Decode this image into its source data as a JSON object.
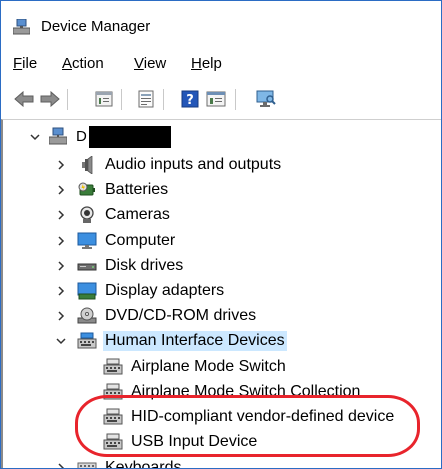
{
  "window": {
    "title": "Device Manager"
  },
  "menu": {
    "file": {
      "label": "File",
      "accel": "F",
      "rest": "ile"
    },
    "action": {
      "label": "Action",
      "accel": "A",
      "rest": "ction"
    },
    "view": {
      "label": "View",
      "accel": "V",
      "rest": "iew"
    },
    "help": {
      "label": "Help",
      "accel": "H",
      "rest": "elp"
    }
  },
  "toolbar": {
    "buttons": [
      "back-icon",
      "forward-icon",
      "properties-icon",
      "update-driver-icon",
      "help-icon",
      "show-hidden-icon",
      "scan-hardware-icon"
    ]
  },
  "tree": {
    "root": {
      "label": "D",
      "redacted": true
    },
    "categories": [
      {
        "label": "Audio inputs and outputs",
        "icon": "speaker-icon",
        "expanded": false
      },
      {
        "label": "Batteries",
        "icon": "battery-icon",
        "expanded": false
      },
      {
        "label": "Cameras",
        "icon": "camera-icon",
        "expanded": false
      },
      {
        "label": "Computer",
        "icon": "monitor-icon",
        "expanded": false
      },
      {
        "label": "Disk drives",
        "icon": "disk-drive-icon",
        "expanded": false
      },
      {
        "label": "Display adapters",
        "icon": "display-adapter-icon",
        "expanded": false
      },
      {
        "label": "DVD/CD-ROM drives",
        "icon": "dvd-drive-icon",
        "expanded": false
      },
      {
        "label": "Human Interface Devices",
        "icon": "hid-icon",
        "expanded": true
      }
    ],
    "hid_children": [
      {
        "label": "Airplane Mode Switch",
        "icon": "hid-device-icon"
      },
      {
        "label": "Airplane Mode Switch Collection",
        "icon": "hid-device-icon"
      },
      {
        "label": "HID-compliant vendor-defined device",
        "icon": "hid-device-icon"
      },
      {
        "label": "USB Input Device",
        "icon": "hid-device-icon"
      }
    ],
    "next_category": {
      "label": "Keyboards",
      "icon": "keyboard-icon",
      "expanded": false
    }
  },
  "annotation": {
    "highlight_color": "#e8242c"
  },
  "colors": {
    "selection": "#cce8ff",
    "window_border": "#2b6cc4"
  }
}
